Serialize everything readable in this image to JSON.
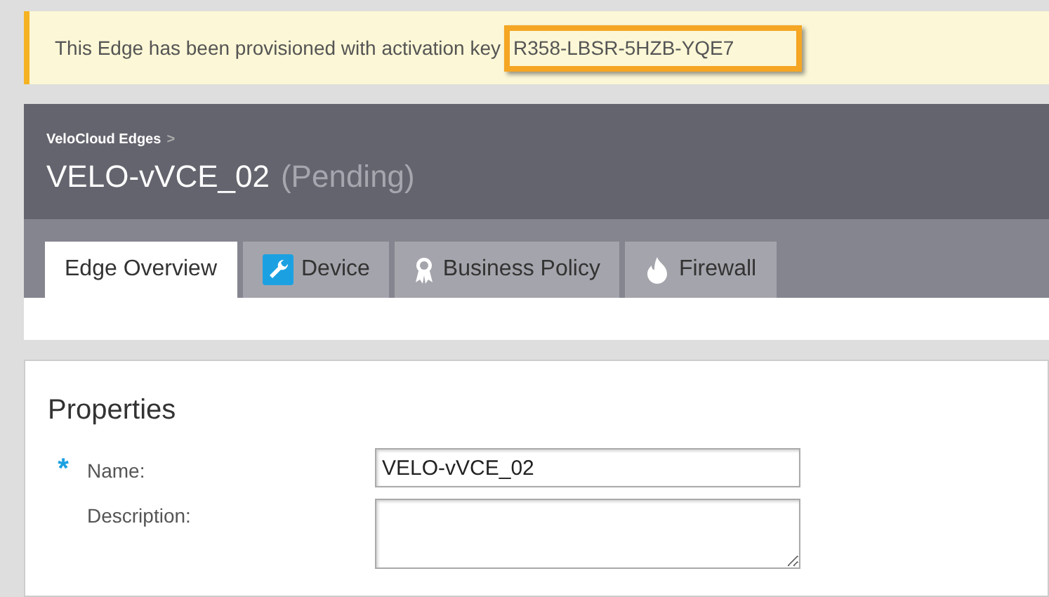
{
  "banner": {
    "message": "This Edge has been provisioned with activation key",
    "activation_key": "R358-LBSR-5HZB-YQE7"
  },
  "header": {
    "breadcrumb": "VeloCloud Edges",
    "breadcrumb_separator": ">",
    "title": "VELO-vVCE_02",
    "status": "(Pending)"
  },
  "tabs": [
    {
      "label": "Edge Overview",
      "selected": true
    },
    {
      "label": "Device",
      "selected": false,
      "kind": "wrench"
    },
    {
      "label": "Business Policy",
      "selected": false,
      "kind": "ribbon"
    },
    {
      "label": "Firewall",
      "selected": false,
      "kind": "flame"
    }
  ],
  "properties": {
    "title": "Properties",
    "fields": [
      {
        "label": "Name:",
        "required_mark": "*",
        "value": "VELO-vVCE_02",
        "kind": "text"
      },
      {
        "label": "Description:",
        "kind": "textarea"
      }
    ]
  }
}
